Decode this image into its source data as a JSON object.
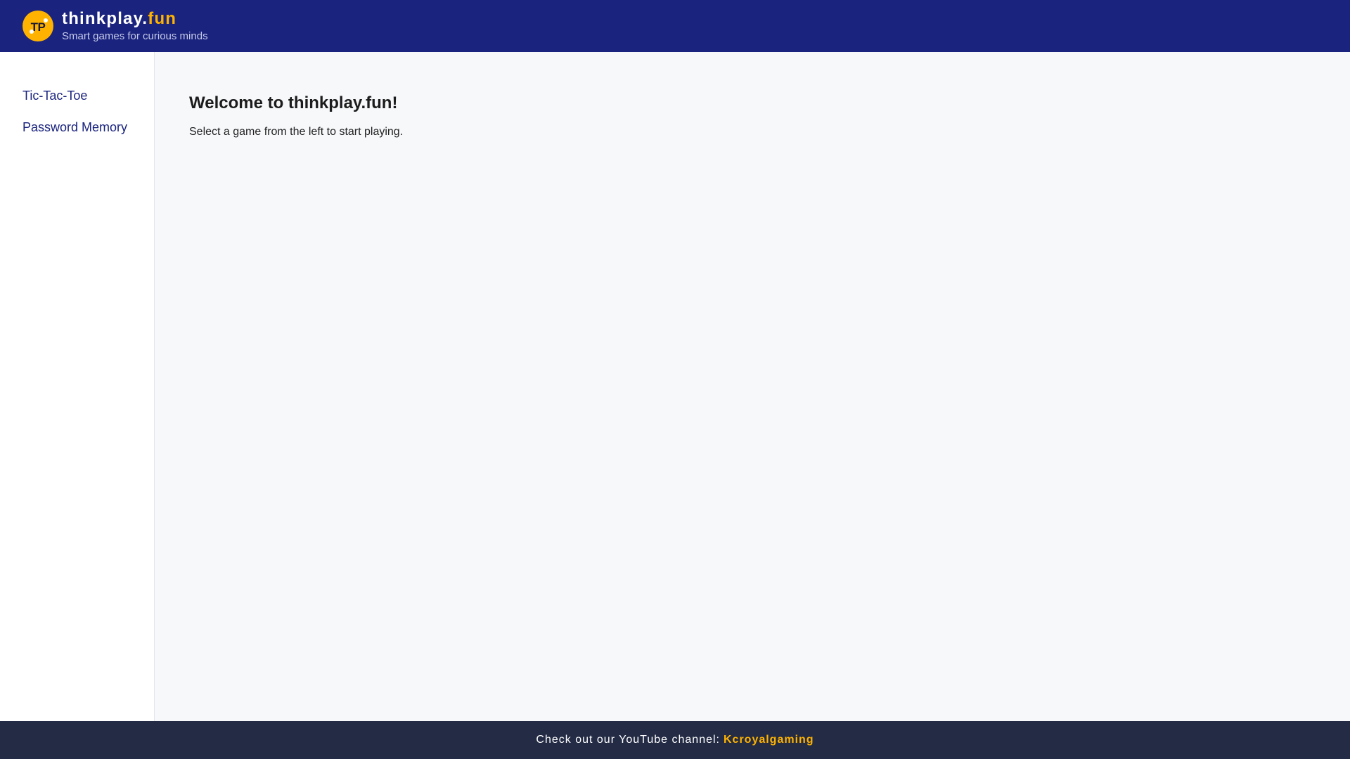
{
  "header": {
    "logo_text": "TP",
    "brand_main": "thinkplay.",
    "brand_accent": "fun",
    "tagline": "Smart games for curious minds"
  },
  "sidebar": {
    "items": [
      {
        "label": "Tic-Tac-Toe"
      },
      {
        "label": "Password Memory"
      }
    ]
  },
  "main": {
    "title": "Welcome to thinkplay.fun!",
    "text": "Select a game from the left to start playing."
  },
  "footer": {
    "text": "Check out our YouTube channel:",
    "link_label": "Kcroyalgaming"
  },
  "colors": {
    "header_bg": "#1a237e",
    "accent": "#ffb300",
    "footer_bg": "#232b45",
    "link": "#1a237e"
  }
}
